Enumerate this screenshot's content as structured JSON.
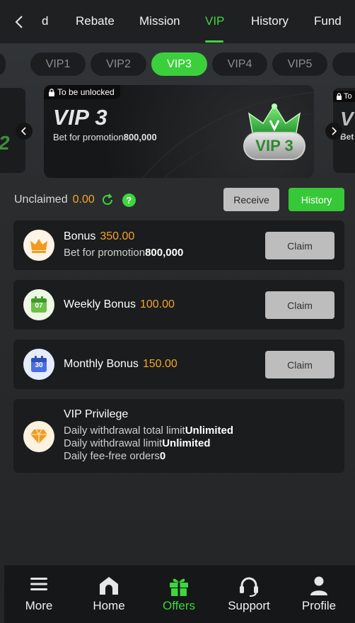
{
  "topnav": {
    "tabs": [
      {
        "label": "d"
      },
      {
        "label": "Rebate"
      },
      {
        "label": "Mission"
      },
      {
        "label": "VIP"
      },
      {
        "label": "History"
      },
      {
        "label": "Fund"
      }
    ],
    "active": "VIP"
  },
  "levels": {
    "pills": [
      "VIP1",
      "VIP2",
      "VIP3",
      "VIP4",
      "VIP5"
    ],
    "active": "VIP3"
  },
  "banner": {
    "lock_label": "To be unlocked",
    "side_lock_label": "To",
    "vip_title": "VIP 3",
    "bet_label": "Bet for promotion",
    "bet_value": "800,000",
    "badge_text": "VIP 3",
    "side_left_text": "2",
    "side_right_text": "V",
    "side_right_sub": "Bet"
  },
  "unclaimed": {
    "label": "Unclaimed",
    "amount": "0.00",
    "receive_label": "Receive",
    "history_label": "History"
  },
  "rewards": {
    "bonus": {
      "title": "Bonus",
      "amount": "350.00",
      "sub_label": "Bet for promotion",
      "sub_value": "800,000",
      "claim": "Claim"
    },
    "weekly": {
      "title": "Weekly Bonus",
      "amount": "100.00",
      "claim": "Claim",
      "icon_number": "07"
    },
    "monthly": {
      "title": "Monthly Bonus",
      "amount": "150.00",
      "claim": "Claim",
      "icon_number": "30"
    }
  },
  "privilege": {
    "title": "VIP Privilege",
    "rows": [
      {
        "label": "Daily withdrawal total limit",
        "value": "Unlimited"
      },
      {
        "label": "Daily withdrawal limit",
        "value": "Unlimited"
      },
      {
        "label": "Daily fee-free orders",
        "value": "0"
      }
    ]
  },
  "bottomnav": {
    "items": [
      {
        "label": "More",
        "icon": "menu-icon"
      },
      {
        "label": "Home",
        "icon": "home-icon"
      },
      {
        "label": "Offers",
        "icon": "gift-icon"
      },
      {
        "label": "Support",
        "icon": "headset-icon"
      },
      {
        "label": "Profile",
        "icon": "user-icon"
      }
    ],
    "active": "Offers"
  },
  "colors": {
    "accent_green": "#3ed63e",
    "amount_orange": "#f5a623",
    "card_bg": "#1b1c1d"
  }
}
